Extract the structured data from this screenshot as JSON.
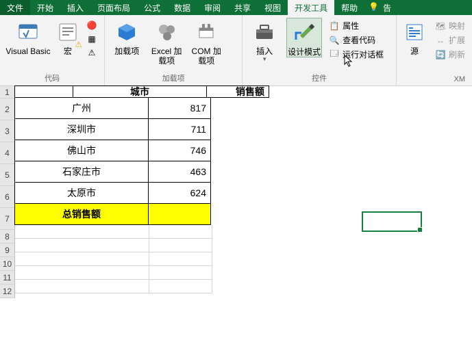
{
  "tabs": {
    "file": "文件",
    "home": "开始",
    "insert": "插入",
    "layout": "页面布局",
    "formula": "公式",
    "data": "数据",
    "review": "审阅",
    "share": "共享",
    "view": "视图",
    "dev": "开发工具",
    "help": "帮助",
    "tell": "告"
  },
  "ribbon": {
    "code": {
      "label": "代码",
      "vb": "Visual Basic",
      "macro": "宏"
    },
    "addins": {
      "label": "加载项",
      "addin": "加载项",
      "excel_addin": "Excel 加载项",
      "com": "COM 加载项"
    },
    "controls": {
      "label": "控件",
      "insert": "插入",
      "design": "设计模式",
      "props": "属性",
      "view_code": "查看代码",
      "run_dialog": "运行对话框"
    },
    "xml": {
      "label": "XM",
      "source": "源",
      "map": "映射",
      "expand": "扩展",
      "refresh": "刷新"
    }
  },
  "sheet": {
    "headers": {
      "colB": "城市",
      "colC": "销售额"
    },
    "rows": [
      {
        "city": "广州",
        "sales": "817"
      },
      {
        "city": "深圳市",
        "sales": "711"
      },
      {
        "city": "佛山市",
        "sales": "746"
      },
      {
        "city": "石家庄市",
        "sales": "463"
      },
      {
        "city": "太原市",
        "sales": "624"
      }
    ],
    "total_label": "总销售额",
    "total_value": ""
  }
}
